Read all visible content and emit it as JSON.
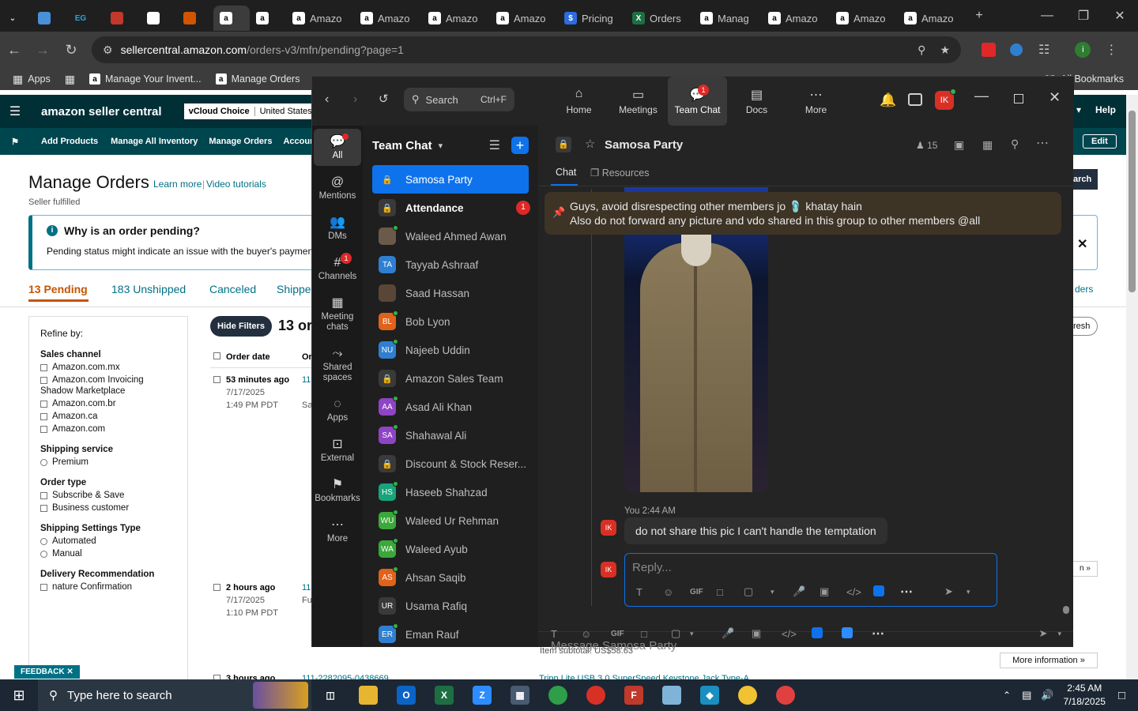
{
  "browser": {
    "tabs": [
      {
        "label": "",
        "icon": "tab-list-icon"
      },
      {
        "label": "",
        "icon": "diamond-icon"
      },
      {
        "label": "",
        "icon": "eg-icon",
        "favtext": "EG"
      },
      {
        "label": "",
        "icon": "pdf-icon"
      },
      {
        "label": "",
        "icon": "google-icon"
      },
      {
        "label": "",
        "icon": "package-icon"
      },
      {
        "label": "",
        "icon": "amazon-icon",
        "favtext": "a"
      },
      {
        "label": "",
        "icon": "amazon-icon",
        "favtext": "a"
      },
      {
        "label": "Amazo",
        "icon": "amazon-icon",
        "favtext": "a"
      },
      {
        "label": "Amazo",
        "icon": "amazon-icon",
        "favtext": "a"
      },
      {
        "label": "Amazo",
        "icon": "amazon-icon",
        "favtext": "a"
      },
      {
        "label": "Amazo",
        "icon": "amazon-icon",
        "favtext": "a"
      },
      {
        "label": "Pricing",
        "icon": "pricing-icon",
        "favtext": "$"
      },
      {
        "label": "Orders",
        "icon": "excel-icon",
        "favtext": "X"
      },
      {
        "label": "Manag",
        "icon": "amazon-icon",
        "favtext": "a"
      },
      {
        "label": "Amazo",
        "icon": "amazon-icon",
        "favtext": "a"
      },
      {
        "label": "Amazo",
        "icon": "amazon-icon",
        "favtext": "a"
      },
      {
        "label": "Amazo",
        "icon": "amazon-icon",
        "favtext": "a"
      }
    ],
    "url_host": "sellercentral.amazon.com",
    "url_path": "/orders-v3/mfn/pending?page=1",
    "bookmarks": [
      {
        "label": "Apps"
      },
      {
        "label": ""
      },
      {
        "label": "Manage Your Invent..."
      },
      {
        "label": "Manage Orders"
      }
    ],
    "all_bookmarks": "All Bookmarks"
  },
  "seller": {
    "logo": "amazon seller central",
    "store_choice": "vCloud Choice",
    "store_country": "United States",
    "help": "Help",
    "nav": [
      "Add Products",
      "Manage All Inventory",
      "Manage Orders",
      "Account Heal"
    ],
    "edit": "Edit",
    "page_title": "Manage Orders",
    "learn_more": "Learn more",
    "video_tutorials": "Video tutorials",
    "subtitle": "Seller fulfilled",
    "banner_title": "Why is an order pending?",
    "banner_text": "Pending status might indicate an issue with the buyer's payment m",
    "tabs": [
      "13 Pending",
      "183 Unshipped",
      "Canceled",
      "Shippe"
    ],
    "tab_right": "ders",
    "search_label": "arch",
    "refresh_label": "resh",
    "refine": "Refine by:",
    "sales_channel_h": "Sales channel",
    "sales_channels": [
      "Amazon.com.mx",
      "Amazon.com Invoicing",
      "Shadow Marketplace",
      "Amazon.com.br",
      "Amazon.ca",
      "Amazon.com"
    ],
    "shipping_service_h": "Shipping service",
    "shipping_services": [
      "Premium"
    ],
    "order_type_h": "Order type",
    "order_types": [
      "Subscribe & Save",
      "Business customer"
    ],
    "shipping_settings_h": "Shipping Settings Type",
    "shipping_settings": [
      "Automated",
      "Manual"
    ],
    "delivery_rec_h": "Delivery Recommendation",
    "delivery_rec_item": "nature Confirmation",
    "hide_filters": "Hide Filters",
    "orders_count_fragment": "13 or",
    "col_order_date": "Order date",
    "col_or": "Or",
    "orders": [
      {
        "age": "53 minutes ago",
        "date": "7/17/2025",
        "time": "1:49 PM PDT",
        "id_frag": "11",
        "sub": "Sa"
      },
      {
        "age": "2 hours ago",
        "date": "7/17/2025",
        "time": "1:10 PM PDT",
        "id_frag": "11",
        "sub": "Fu"
      }
    ],
    "third_order_age": "3 hours ago",
    "third_order_id": "111-2282095-0438669",
    "third_order_product": "Tripp Lite USB 3.0 SuperSpeed Keystone Jack Type-A",
    "item_subtotal": "Item subtotal: US$58.63",
    "more_information": "More information »",
    "feedback": "FEEDBACK"
  },
  "zoom": {
    "search_label": "Search",
    "search_shortcut": "Ctrl+F",
    "top_nav": [
      {
        "label": "Home",
        "icon": "home-icon"
      },
      {
        "label": "Meetings",
        "icon": "video-camera-icon"
      },
      {
        "label": "Team Chat",
        "icon": "chat-bubble-icon",
        "badge": "1"
      },
      {
        "label": "Docs",
        "icon": "document-icon"
      },
      {
        "label": "More",
        "icon": "more-dots-icon"
      }
    ],
    "profile_initials": "IK",
    "left_nav": [
      {
        "label": "All",
        "icon": "chat-icon"
      },
      {
        "label": "Mentions",
        "icon": "at-icon"
      },
      {
        "label": "DMs",
        "icon": "people-icon"
      },
      {
        "label": "Channels",
        "icon": "hash-icon",
        "badge": "1"
      },
      {
        "label": "Meeting chats",
        "icon": "calendar-icon"
      },
      {
        "label": "Shared spaces",
        "icon": "share-icon"
      },
      {
        "label": "Apps",
        "icon": "apps-icon"
      },
      {
        "label": "External",
        "icon": "external-icon"
      },
      {
        "label": "Bookmarks",
        "icon": "bookmark-icon"
      },
      {
        "label": "More",
        "icon": "more-dots-icon"
      }
    ],
    "list_title": "Team Chat",
    "chats": [
      {
        "name": "Samosa Party",
        "type": "lock",
        "selected": true
      },
      {
        "name": "Attendance",
        "type": "lock",
        "bold": true,
        "badge": "1"
      },
      {
        "name": "Waleed Ahmed Awan",
        "type": "photo",
        "color": "#6b5a4a",
        "online": true
      },
      {
        "name": "Tayyab Ashraaf",
        "type": "initials",
        "initials": "TA",
        "color": "#2f7fd1"
      },
      {
        "name": "Saad Hassan",
        "type": "photo",
        "color": "#5a4636"
      },
      {
        "name": "Bob Lyon",
        "type": "initials",
        "initials": "BL",
        "color": "#e0621b",
        "online": true
      },
      {
        "name": "Najeeb Uddin",
        "type": "initials",
        "initials": "NU",
        "color": "#2f7fd1",
        "online": true
      },
      {
        "name": "Amazon Sales Team",
        "type": "lock"
      },
      {
        "name": "Asad Ali Khan",
        "type": "initials",
        "initials": "AA",
        "color": "#8e44c4",
        "online": true
      },
      {
        "name": "Shahawal Ali",
        "type": "initials",
        "initials": "SA",
        "color": "#8e44c4",
        "online": true
      },
      {
        "name": "Discount & Stock Reser...",
        "type": "lock"
      },
      {
        "name": "Haseeb Shahzad",
        "type": "initials",
        "initials": "HS",
        "color": "#1aa37a",
        "online": true
      },
      {
        "name": "Waleed Ur Rehman",
        "type": "initials",
        "initials": "WU",
        "color": "#3aa83a",
        "online": true
      },
      {
        "name": "Waleed Ayub",
        "type": "initials",
        "initials": "WA",
        "color": "#3aa83a",
        "online": true
      },
      {
        "name": "Ahsan Saqib",
        "type": "initials",
        "initials": "AS",
        "color": "#e0621b",
        "online": true
      },
      {
        "name": "Usama Rafiq",
        "type": "initials",
        "initials": "UR",
        "color": "#3a3a3a"
      },
      {
        "name": "Eman Rauf",
        "type": "initials",
        "initials": "ER",
        "color": "#2f7fd1",
        "online": true
      }
    ],
    "channel_name": "Samosa Party",
    "member_count": "15",
    "tab_chat": "Chat",
    "tab_resources": "Resources",
    "pinned_line1": "Guys, avoid disrespecting other members jo 🩴 khatay hain",
    "pinned_line2": "Also do not forward any picture and vdo shared in this group to other members @all",
    "msg_sender": "You",
    "msg_time": "2:44 AM",
    "msg_text": "do not share this pic I can't handle the temptation",
    "reply_placeholder": "Reply...",
    "message_placeholder": "Message Samosa Party",
    "gif_label": "GIF"
  },
  "taskbar": {
    "search_placeholder": "Type here to search",
    "time": "2:45 AM",
    "date": "7/18/2025"
  },
  "colors": {
    "zoom_blue": "#0e72ed",
    "seller_dark": "#002f36",
    "pending_orange": "#c45500",
    "notification_red": "#e02828"
  }
}
